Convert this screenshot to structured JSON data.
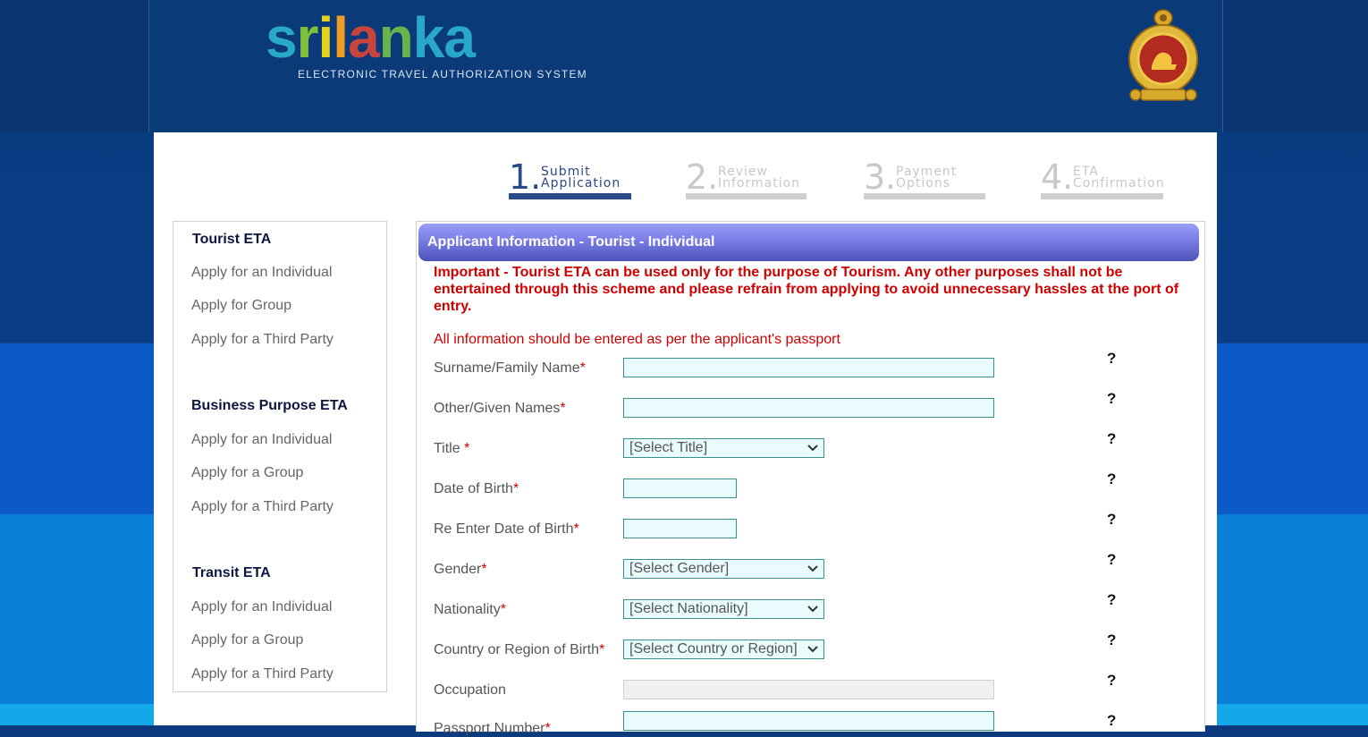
{
  "header": {
    "logo_letters": [
      "s",
      "r",
      "i",
      "l",
      "a",
      "n",
      "k",
      "a"
    ],
    "logo_subtitle": "ELECTRONIC TRAVEL AUTHORIZATION SYSTEM",
    "emblem_icon": "sri-lanka-emblem-icon"
  },
  "steps": [
    {
      "number": "1.",
      "line1": "Submit",
      "line2": "Application",
      "state": "active"
    },
    {
      "number": "2.",
      "line1": "Review",
      "line2": "Information",
      "state": "inactive"
    },
    {
      "number": "3.",
      "line1": "Payment",
      "line2": "Options",
      "state": "inactive"
    },
    {
      "number": "4.",
      "line1": "ETA",
      "line2": "Confirmation",
      "state": "inactive"
    }
  ],
  "sidebar": {
    "sections": [
      {
        "heading": "Tourist ETA",
        "links": [
          "Apply for an Individual",
          "Apply for Group",
          "Apply for a Third Party"
        ]
      },
      {
        "heading": "Business Purpose ETA",
        "links": [
          "Apply for an Individual",
          "Apply for a Group",
          "Apply for a Third Party"
        ]
      },
      {
        "heading": "Transit ETA",
        "links": [
          "Apply for an Individual",
          "Apply for a Group",
          "Apply for a Third Party"
        ]
      }
    ]
  },
  "form": {
    "title": "Applicant Information - Tourist - Individual",
    "important": "Important - Tourist ETA can be used only for the purpose of Tourism. Any other purposes shall not be entertained through this scheme and please refrain from applying to avoid unnecessary hassles at the port of entry.",
    "passport_note": "All information should be entered as per the applicant's passport",
    "required_mark": "*",
    "help_mark": "?",
    "fields": {
      "surname": {
        "label": "Surname/Family Name",
        "value": ""
      },
      "given_names": {
        "label": "Other/Given Names",
        "value": ""
      },
      "title": {
        "label": "Title ",
        "selected": "[Select Title]"
      },
      "dob": {
        "label": "Date of Birth",
        "value": ""
      },
      "dob_confirm": {
        "label": "Re Enter Date of Birth",
        "value": ""
      },
      "gender": {
        "label": "Gender",
        "selected": "[Select Gender]"
      },
      "nationality": {
        "label": "Nationality",
        "selected": "[Select Nationality]"
      },
      "country_of_birth": {
        "label": "Country or Region of Birth",
        "selected": "[Select Country or Region]"
      },
      "occupation": {
        "label": "Occupation",
        "value": ""
      },
      "passport_number": {
        "label": "Passport Number",
        "value": ""
      }
    }
  },
  "colors": {
    "accent": "#2a4a8a",
    "required": "#d00000",
    "input_bg": "#eafbfd",
    "input_border": "#3a8f8f"
  }
}
